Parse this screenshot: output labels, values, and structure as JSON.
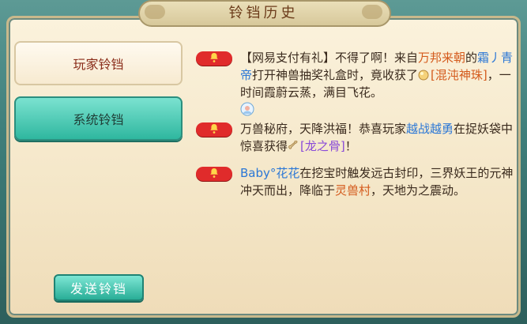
{
  "window": {
    "title": "铃铛历史"
  },
  "sidebar": {
    "tabs": [
      {
        "label": "玩家铃铛"
      },
      {
        "label": "系统铃铛"
      }
    ]
  },
  "footer": {
    "send_button": "发送铃铛"
  },
  "messages": [
    {
      "parts": [
        {
          "t": "【网易支付有礼】不得了啊！来自"
        },
        {
          "t": "万邦来朝",
          "c": "orange"
        },
        {
          "t": "的"
        },
        {
          "t": "霜丿青帝",
          "c": "blue"
        },
        {
          "t": "打开神兽抽奖礼盒时，竟收获了"
        },
        {
          "t": "[混沌神珠]",
          "c": "orange"
        },
        {
          "t": "，一时间霞蔚云蒸，满目飞花。"
        }
      ]
    },
    {
      "parts": [
        {
          "t": "万兽秘府，天降洪福！恭喜玩家"
        },
        {
          "t": "越战越勇",
          "c": "blue"
        },
        {
          "t": "在捉妖袋中惊喜获得"
        },
        {
          "t": "[龙之骨]",
          "c": "purple"
        },
        {
          "t": "！"
        }
      ]
    },
    {
      "parts": [
        {
          "t": "Baby°花花",
          "c": "blue"
        },
        {
          "t": "在挖宝时触发远古封印，三界妖王的元神冲天而出，降临于"
        },
        {
          "t": "灵兽村",
          "c": "orange"
        },
        {
          "t": "，天地为之震动。"
        }
      ]
    }
  ],
  "icons": {
    "bell": "bell-icon",
    "pearl": "chaos-pearl-item-icon",
    "bone": "dragon-bone-item-icon",
    "avatar": "player-avatar-icon"
  },
  "colors": {
    "accent_teal": "#2fb79f",
    "badge_red": "#e02b2b",
    "name_blue": "#2b77d6",
    "item_orange": "#d45a1c",
    "item_purple": "#8a4bd8"
  }
}
